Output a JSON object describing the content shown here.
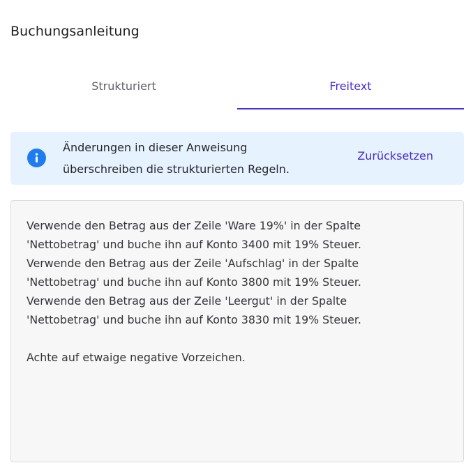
{
  "panel": {
    "title": "Buchungsanleitung"
  },
  "tabs": [
    {
      "label": "Strukturiert",
      "active": false
    },
    {
      "label": "Freitext",
      "active": true
    }
  ],
  "notice": {
    "icon": "info-icon",
    "lines": [
      "Änderungen in dieser Anweisung",
      "überschreiben die strukturierten Regeln."
    ],
    "action_label": "Zurücksetzen"
  },
  "instructions": {
    "lines": [
      "Verwende den Betrag aus der Zeile 'Ware 19%' in der Spalte",
      "'Nettobetrag' und buche ihn auf Konto 3400 mit 19% Steuer.",
      "Verwende den Betrag aus der Zeile 'Aufschlag' in der Spalte",
      "'Nettobetrag' und buche ihn auf Konto 3800 mit 19% Steuer.",
      "Verwende den Betrag aus der Zeile 'Leergut' in der Spalte",
      "'Nettobetrag' und buche ihn auf Konto 3830 mit 19% Steuer.",
      "",
      "Achte auf etwaige negative Vorzeichen."
    ]
  },
  "colors": {
    "accent": "#4a2ed6",
    "info_background": "#e6f3ff",
    "info_icon": "#1f7cf0",
    "textarea_background": "#f7f7f7"
  }
}
